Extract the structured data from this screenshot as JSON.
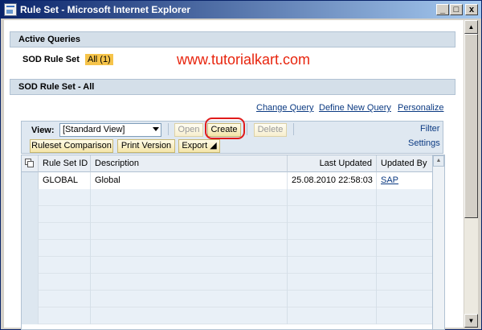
{
  "window": {
    "title": "Rule Set - Microsoft Internet Explorer",
    "controls": {
      "minimize": "_",
      "maximize": "□",
      "close": "x"
    }
  },
  "active_queries": {
    "header": "Active Queries",
    "query_label": "SOD Rule Set",
    "query_badge": "All (1)"
  },
  "watermark": "www.tutorialkart.com",
  "rule_set_section": {
    "header": "SOD Rule Set - All",
    "links": {
      "change_query": "Change Query",
      "define_new_query": "Define New Query",
      "personalize": "Personalize"
    }
  },
  "toolbar": {
    "view_label": "View:",
    "view_value": "[Standard View]",
    "open_label": "Open",
    "create_label": "Create",
    "delete_label": "Delete",
    "ruleset_comparison_label": "Ruleset Comparison",
    "print_version_label": "Print Version",
    "export_label": "Export ◢",
    "filter_label": "Filter",
    "settings_label": "Settings"
  },
  "table": {
    "columns": [
      "Rule Set ID",
      "Description",
      "Last Updated",
      "Updated By"
    ],
    "rows": [
      {
        "rule_set_id": "GLOBAL",
        "description": "Global",
        "last_updated": "25.08.2010 22:58:03",
        "updated_by": "SAP"
      }
    ]
  },
  "colors": {
    "title_bar": "#0a246a",
    "tray_header": "#d4dfe9",
    "badge": "#f6c44a",
    "watermark": "#e8250e",
    "link": "#0b3a82",
    "highlight_ring": "#e01b1b"
  },
  "icons": {
    "table_settings": "table-settings-icon",
    "scroll_up": "scroll-up-icon",
    "scroll_down": "scroll-down-icon"
  }
}
